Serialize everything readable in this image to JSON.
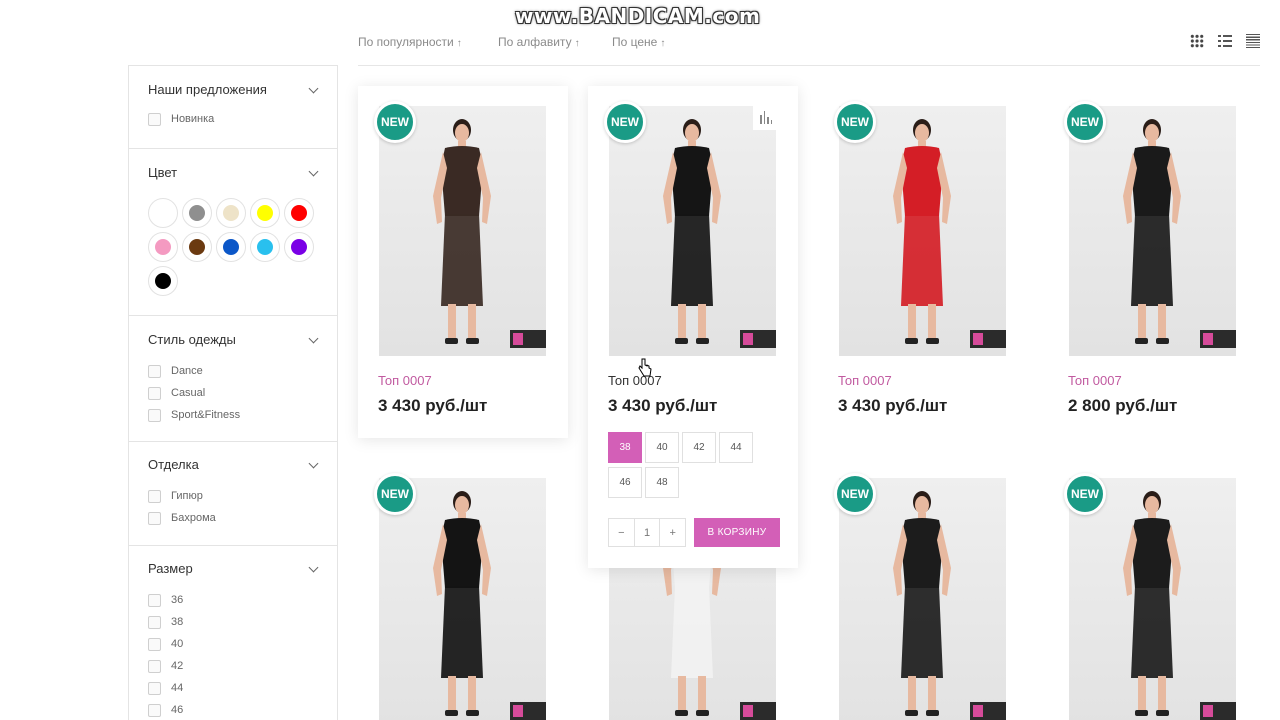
{
  "watermark": "www.BANDICAM.com",
  "sort": {
    "options": [
      {
        "label": "По популярности",
        "arrow": "↑"
      },
      {
        "label": "По алфавиту",
        "arrow": "↑"
      },
      {
        "label": "По цене",
        "arrow": "↑"
      }
    ]
  },
  "view_modes": [
    "grid-view-icon",
    "list-view-icon",
    "table-view-icon"
  ],
  "filters": {
    "offers": {
      "title": "Наши предложения",
      "items": [
        "Новинка"
      ]
    },
    "color": {
      "title": "Цвет",
      "swatches": [
        "#ffffff",
        "#8f8f8f",
        "#eee3c8",
        "#ffff00",
        "#ff0000",
        "#f49ac1",
        "#6b3a10",
        "#0b57c8",
        "#29c0ee",
        "#7a00e6",
        "#000000"
      ]
    },
    "style": {
      "title": "Стиль одежды",
      "items": [
        "Dance",
        "Casual",
        "Sport&Fitness"
      ]
    },
    "finish": {
      "title": "Отделка",
      "items": [
        "Гипюр",
        "Бахрома"
      ]
    },
    "size": {
      "title": "Размер",
      "items": [
        "36",
        "38",
        "40",
        "42",
        "44",
        "46"
      ]
    }
  },
  "badge_label": "NEW",
  "products": [
    {
      "name": "Топ 0007",
      "price": "3 430 руб./шт",
      "garment": "#3a2a24"
    },
    {
      "name": "Топ 0007",
      "price": "3 430 руб./шт",
      "garment": "#151515"
    },
    {
      "name": "Топ 0007",
      "price": "3 430 руб./шт",
      "garment": "#d41e26"
    },
    {
      "name": "Топ 0007",
      "price": "2 800 руб./шт",
      "garment": "#1a1a1a"
    },
    {
      "garment": "#141414"
    },
    {
      "garment": "#f2f2f2"
    },
    {
      "garment": "#1c1c1c"
    },
    {
      "garment": "#1c1c1c"
    }
  ],
  "hover_card": {
    "sizes": [
      "38",
      "40",
      "42",
      "44",
      "46",
      "48"
    ],
    "selected_size": "38",
    "qty_minus": "−",
    "qty_value": "1",
    "qty_plus": "+",
    "cart_label": "В КОРЗИНУ"
  },
  "colors": {
    "accent": "#d35fb7",
    "badge": "#1a9b86",
    "link": "#c15aa0"
  }
}
